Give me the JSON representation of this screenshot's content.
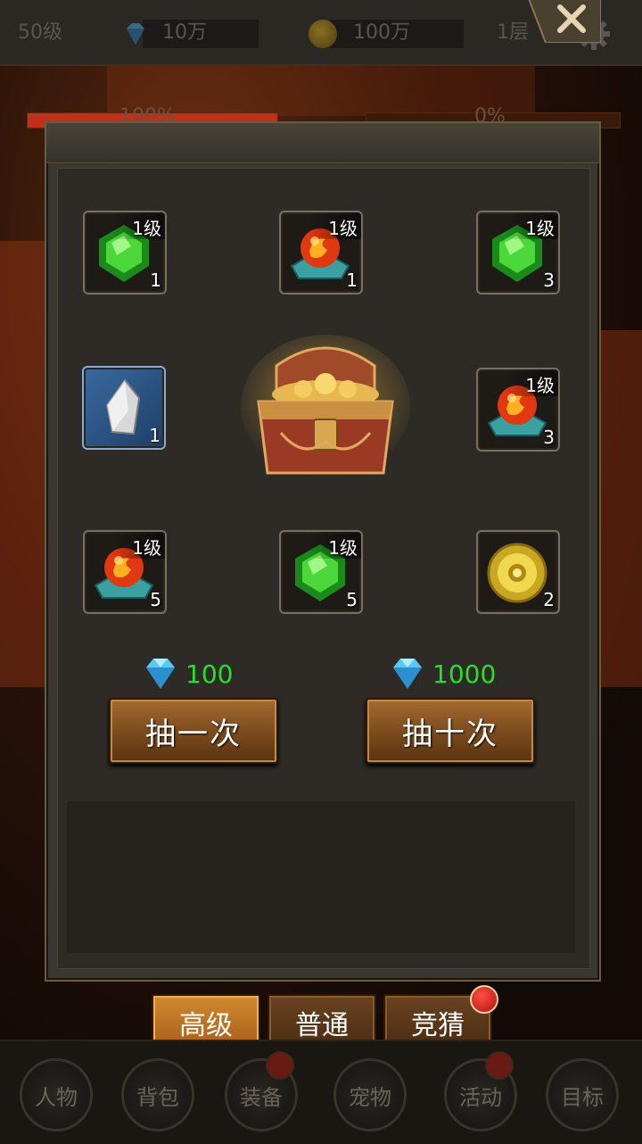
{
  "topbar": {
    "level": "50级",
    "diamonds": "10万",
    "gold": "100万",
    "floor": "1层",
    "settings_icon": "gear-icon"
  },
  "background": {
    "left_progress_text": "100%",
    "right_progress_text": "0%",
    "left_progress_value": 1.0,
    "right_progress_value": 0.0
  },
  "modal": {
    "close_icon": "close-icon",
    "items": [
      {
        "type": "green-gem",
        "level": "1级",
        "count": "1"
      },
      {
        "type": "fire-orb",
        "level": "1级",
        "count": "1"
      },
      {
        "type": "green-gem",
        "level": "1级",
        "count": "3"
      },
      {
        "type": "silver-crystal",
        "level": "",
        "count": "1"
      },
      {
        "type": "fire-orb",
        "level": "1级",
        "count": "3"
      },
      {
        "type": "fire-orb",
        "level": "1级",
        "count": "5"
      },
      {
        "type": "green-gem",
        "level": "1级",
        "count": "5"
      },
      {
        "type": "gold-coin",
        "level": "",
        "count": "2"
      }
    ],
    "draw_once": {
      "cost": "100",
      "label": "抽一次"
    },
    "draw_ten": {
      "cost": "1000",
      "label": "抽十次"
    }
  },
  "tabs": [
    {
      "label": "高级",
      "active": true
    },
    {
      "label": "普通",
      "active": false
    },
    {
      "label": "竞猜",
      "active": false,
      "badge": true
    }
  ],
  "bottom_nav": [
    {
      "label": "人物",
      "badge": false
    },
    {
      "label": "背包",
      "badge": false
    },
    {
      "label": "装备",
      "badge": true
    },
    {
      "label": "宠物",
      "badge": false
    },
    {
      "label": "活动",
      "badge": true
    },
    {
      "label": "目标",
      "badge": false
    }
  ],
  "colors": {
    "cost_text": "#27e02a",
    "button_brown": "#7a4a1c",
    "active_tab": "#d08a30",
    "badge_red": "#e02a20"
  }
}
